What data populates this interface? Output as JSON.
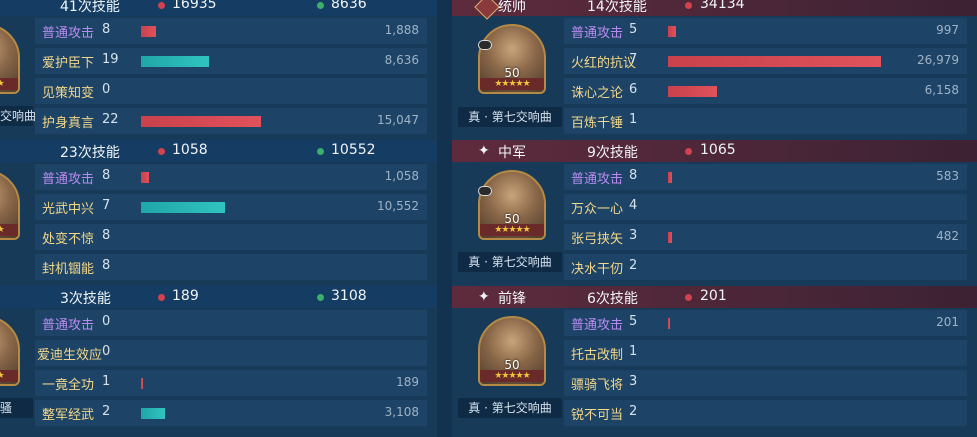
{
  "left": {
    "sections": [
      {
        "casts": "41次技能",
        "damage": "16935",
        "heal": "8636",
        "tactic_fragment": "交响曲",
        "skills": [
          {
            "name": "普通攻击",
            "count": "8",
            "value": "1,888",
            "bar": "red",
            "fraction": 0.125,
            "basic": true
          },
          {
            "name": "爱护臣下",
            "count": "19",
            "value": "8,636",
            "bar": "teal",
            "fraction": 0.57
          },
          {
            "name": "见策知变",
            "count": "0",
            "value": "",
            "bar": "",
            "fraction": 0
          },
          {
            "name": "护身真言",
            "count": "22",
            "value": "15,047",
            "bar": "red",
            "fraction": 1.0
          }
        ]
      },
      {
        "casts": "23次技能",
        "damage": "1058",
        "heal": "10552",
        "skills": [
          {
            "name": "普通攻击",
            "count": "8",
            "value": "1,058",
            "bar": "red",
            "fraction": 0.07,
            "basic": true
          },
          {
            "name": "光武中兴",
            "count": "7",
            "value": "10,552",
            "bar": "teal",
            "fraction": 0.7
          },
          {
            "name": "处变不惊",
            "count": "8",
            "value": "",
            "bar": "",
            "fraction": 0
          },
          {
            "name": "封机锢能",
            "count": "8",
            "value": "",
            "bar": "",
            "fraction": 0
          }
        ]
      },
      {
        "casts": "3次技能",
        "damage": "189",
        "heal": "3108",
        "tactic_fragment": "骚",
        "skills": [
          {
            "name": "普通攻击",
            "count": "0",
            "value": "",
            "bar": "",
            "fraction": 0,
            "basic": true
          },
          {
            "name": "爱迪生效应",
            "count": "0",
            "value": "",
            "bar": "",
            "fraction": 0
          },
          {
            "name": "一竟全功",
            "count": "1",
            "value": "189",
            "bar": "red",
            "fraction": 0.015
          },
          {
            "name": "整军经武",
            "count": "2",
            "value": "3,108",
            "bar": "teal",
            "fraction": 0.2
          }
        ]
      }
    ]
  },
  "right": {
    "sections": [
      {
        "role": "统帅",
        "casts": "14次技能",
        "damage": "34134",
        "level": "50",
        "tactic": "真 · 第七交响曲",
        "skills": [
          {
            "name": "普通攻击",
            "count": "5",
            "value": "997",
            "bar": "red",
            "fraction": 0.037,
            "basic": true
          },
          {
            "name": "火红的抗议",
            "count": "7",
            "value": "26,979",
            "bar": "red",
            "fraction": 1.0
          },
          {
            "name": "诛心之论",
            "count": "6",
            "value": "6,158",
            "bar": "red",
            "fraction": 0.23
          },
          {
            "name": "百炼千锤",
            "count": "1",
            "value": "",
            "bar": "",
            "fraction": 0
          }
        ]
      },
      {
        "role": "中军",
        "casts": "9次技能",
        "damage": "1065",
        "level": "50",
        "tactic": "真 · 第七交响曲",
        "skills": [
          {
            "name": "普通攻击",
            "count": "8",
            "value": "583",
            "bar": "red",
            "fraction": 0.02,
            "basic": true
          },
          {
            "name": "万众一心",
            "count": "4",
            "value": "",
            "bar": "",
            "fraction": 0
          },
          {
            "name": "张弓挟矢",
            "count": "3",
            "value": "482",
            "bar": "red",
            "fraction": 0.018
          },
          {
            "name": "决水干仞",
            "count": "2",
            "value": "",
            "bar": "",
            "fraction": 0
          }
        ]
      },
      {
        "role": "前锋",
        "casts": "6次技能",
        "damage": "201",
        "level": "50",
        "tactic": "真 · 第七交响曲",
        "skills": [
          {
            "name": "普通攻击",
            "count": "5",
            "value": "201",
            "bar": "red",
            "fraction": 0.008,
            "basic": true
          },
          {
            "name": "托古改制",
            "count": "1",
            "value": "",
            "bar": "",
            "fraction": 0
          },
          {
            "name": "骠骑飞将",
            "count": "3",
            "value": "",
            "bar": "",
            "fraction": 0
          },
          {
            "name": "锐不可当",
            "count": "2",
            "value": "",
            "bar": "",
            "fraction": 0
          }
        ]
      }
    ]
  },
  "colors": {
    "damage": "#d1424e",
    "heal": "#3bb06a",
    "basic_skill": "#b98bf0",
    "skill": "#f3d78a"
  }
}
